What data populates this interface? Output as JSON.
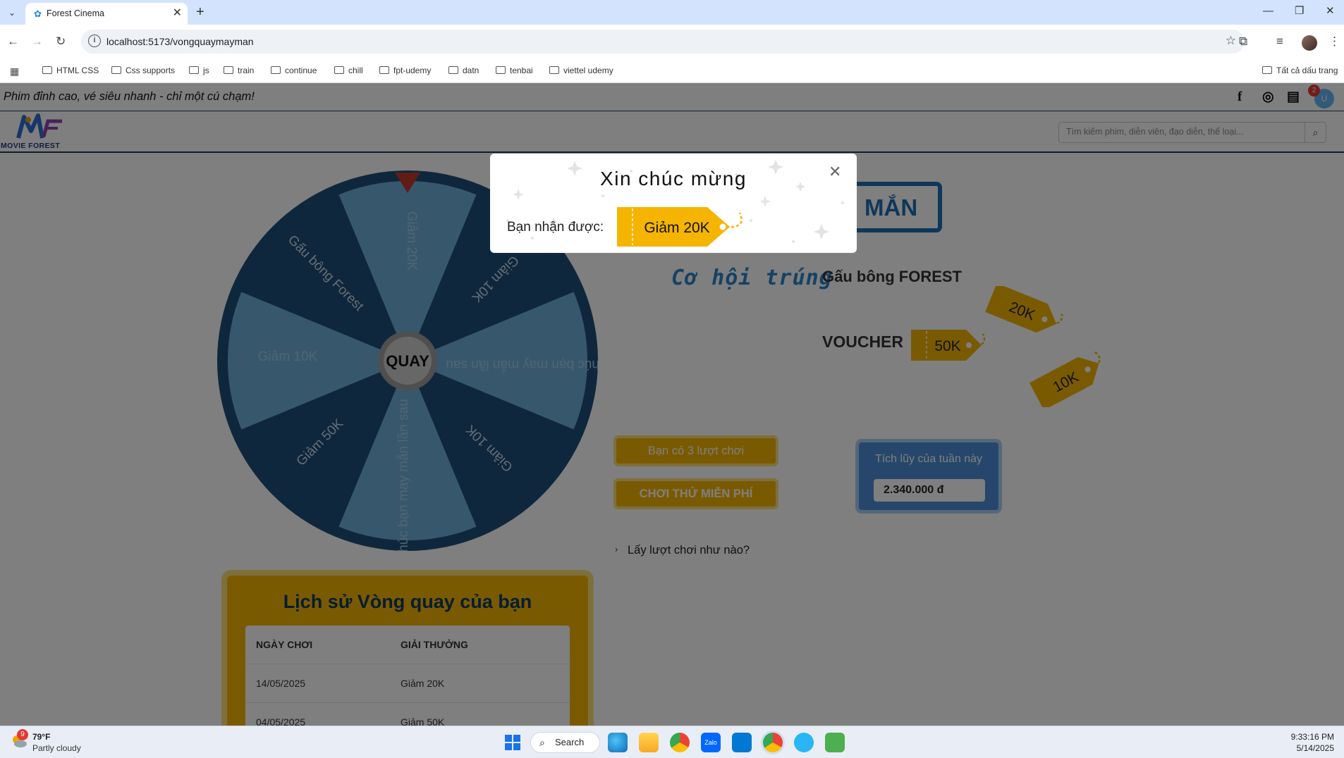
{
  "browser": {
    "tab_title": "Forest Cinema",
    "url": "localhost:5173/vongquaymayman",
    "bookmarks": [
      "HTML CSS",
      "Css supports",
      "js",
      "train",
      "continue",
      "chill",
      "fpt-udemy",
      "datn",
      "tenbai",
      "viettel udemy"
    ],
    "all_bookmarks": "Tất cả dấu trang"
  },
  "topbar": {
    "slogan": "Phim đỉnh cao, vé siêu nhanh - chỉ một cú chạm!",
    "notification_count": "2",
    "avatar_initial": "U"
  },
  "header": {
    "logo_text": "MOVIE FOREST",
    "search_placeholder": "Tìm kiếm phim, diễn viên, đạo diễn, thể loại..."
  },
  "wheel": {
    "center_label": "QUAY",
    "segments": [
      "Giảm 20K",
      "Giảm 10K",
      "Chúc bạn may mắn lần sau",
      "Giảm 10K",
      "Chúc bạn may mắn lần sau",
      "Giảm 50K",
      "Giảm 10K",
      "Gấu bông Forest"
    ]
  },
  "promo": {
    "title_fragment": "MẮN",
    "chance_title": "Cơ hội trúng",
    "prize_name": "Gấu bông FOREST",
    "voucher_label": "VOUCHER",
    "voucher_tags": [
      "50K",
      "20K",
      "10K"
    ]
  },
  "actions": {
    "turns_text": "Bạn có 3 lượt chơi",
    "free_play": "CHƠI THỬ MIỄN PHÍ",
    "howto": "Lấy lượt chơi như nào?"
  },
  "accumulation": {
    "label": "Tích lũy của tuần này",
    "value": "2.340.000 đ"
  },
  "history": {
    "title": "Lịch sử Vòng quay của bạn",
    "columns": [
      "NGÀY CHƠI",
      "GIẢI THƯỞNG"
    ],
    "rows": [
      {
        "date": "14/05/2025",
        "prize": "Giảm 20K"
      },
      {
        "date": "04/05/2025",
        "prize": "Giảm 50K"
      }
    ]
  },
  "modal": {
    "title": "Xin chúc mừng",
    "label": "Bạn nhận được:",
    "prize": "Giảm 20K"
  },
  "taskbar": {
    "weather_badge": "9",
    "temperature": "79°F",
    "weather": "Partly cloudy",
    "search": "Search",
    "time": "9:33:16 PM",
    "date": "5/14/2025"
  },
  "colors": {
    "wheel_dark": "#1f4e79",
    "wheel_light": "#6fb0d8",
    "gold": "#f5b400",
    "accent_blue": "#1e6fb5",
    "pointer_red": "#c0392b"
  }
}
